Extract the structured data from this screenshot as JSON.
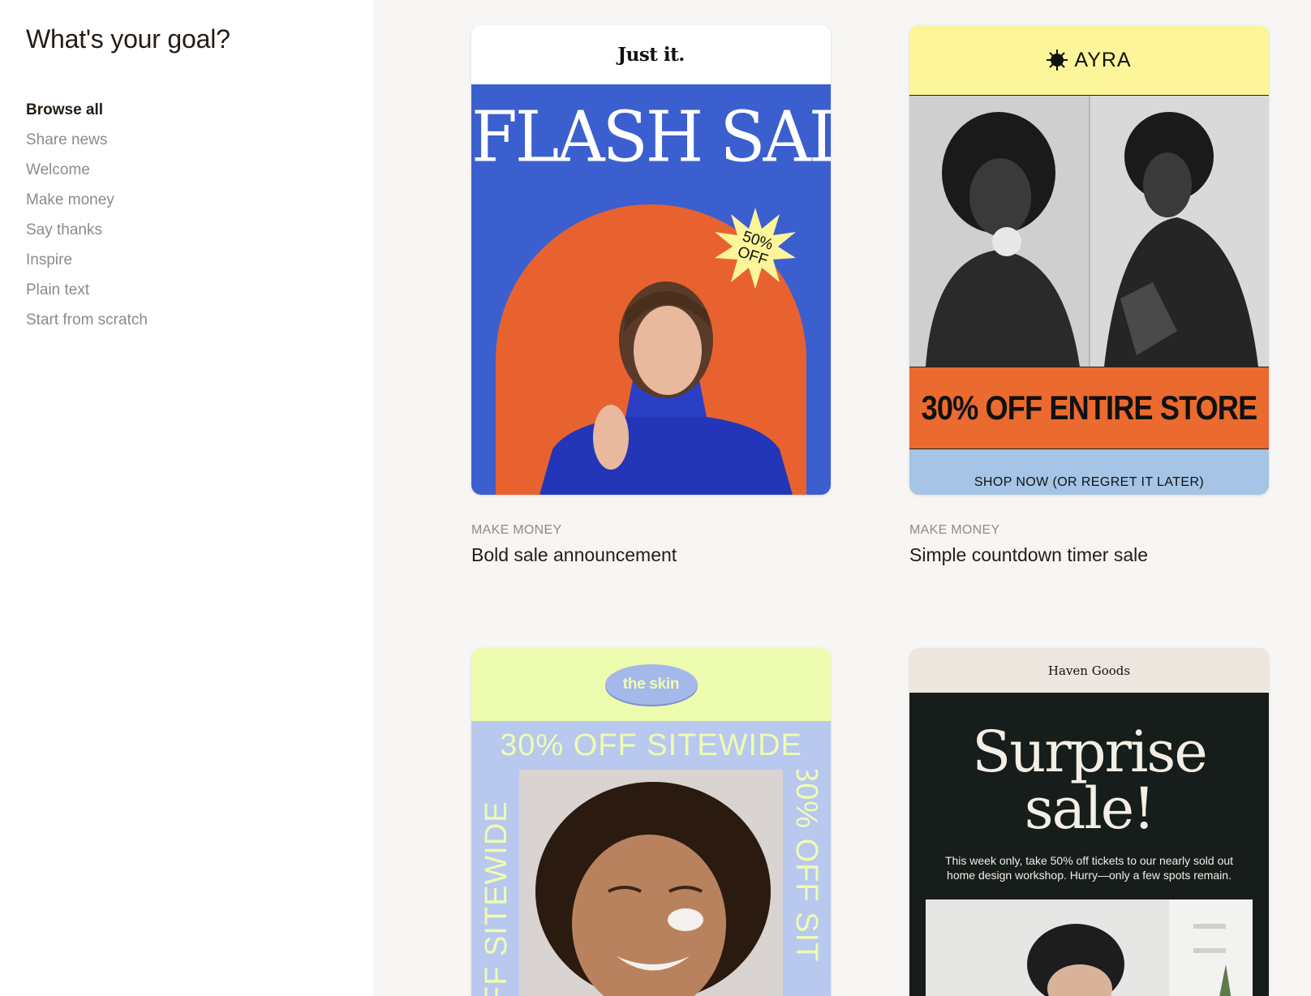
{
  "sidebar": {
    "heading": "What's your goal?",
    "items": [
      {
        "label": "Browse all",
        "active": true
      },
      {
        "label": "Share news"
      },
      {
        "label": "Welcome"
      },
      {
        "label": "Make money"
      },
      {
        "label": "Say thanks"
      },
      {
        "label": "Inspire"
      },
      {
        "label": "Plain text"
      },
      {
        "label": "Start from scratch"
      }
    ]
  },
  "templates": [
    {
      "category": "MAKE MONEY",
      "title": "Bold sale announcement",
      "preview": {
        "brand": "Just it.",
        "headline": "FLASH SALE",
        "badge_line1": "50%",
        "badge_line2": "OFF",
        "colors": {
          "background": "#3b5fcf",
          "arch": "#e8622f",
          "badge": "#fdf59a"
        }
      }
    },
    {
      "category": "MAKE MONEY",
      "title": "Simple countdown timer sale",
      "preview": {
        "brand": "AYRA",
        "headline": "30% OFF ENTIRE STORE",
        "cta": "SHOP NOW (OR REGRET IT LATER)",
        "colors": {
          "header": "#fdf59a",
          "band": "#ea6a2f",
          "footer": "#a5c4e6"
        }
      }
    },
    {
      "preview": {
        "brand": "the skin",
        "band_text": "30% OFF SITEWIDE",
        "side_left": "FF SITEWIDE",
        "side_right": "30% OFF SIT",
        "colors": {
          "header": "#eefcb0",
          "band": "#b9c8ef"
        }
      }
    },
    {
      "preview": {
        "brand": "Haven Goods",
        "headline_line1": "Surprise",
        "headline_line2": "sale!",
        "body": "This week only, take 50% off tickets to our nearly sold out home design workshop. Hurry—only a few spots remain.",
        "colors": {
          "header": "#ece6df",
          "body": "#161d1a"
        }
      }
    }
  ]
}
